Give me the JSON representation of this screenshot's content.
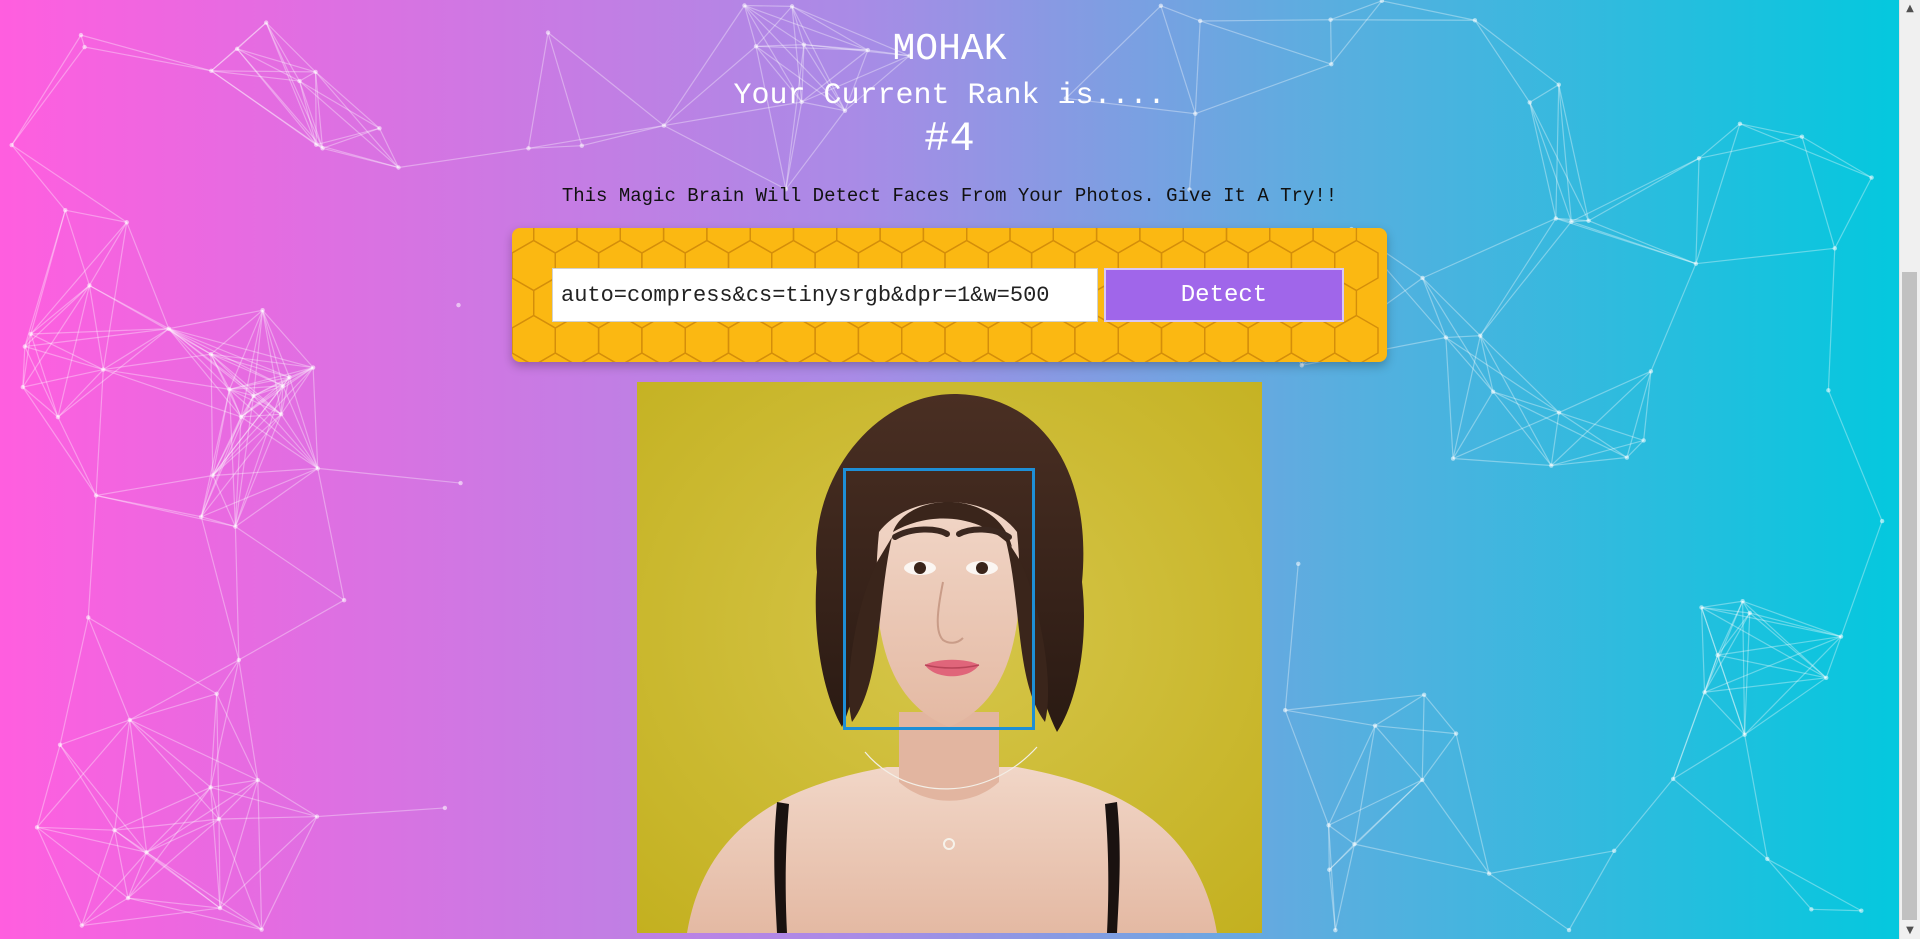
{
  "user": {
    "name": "MOHAK",
    "rank_label": "Your Current Rank is....",
    "rank_value": "#4"
  },
  "tagline": "This Magic Brain Will Detect Faces From Your Photos. Give It A Try!!",
  "form": {
    "url_value": "auto=compress&cs=tinysrgb&dpr=1&w=500",
    "detect_label": "Detect"
  },
  "colors": {
    "gradient_left": "#ff5edf",
    "gradient_right": "#04c8de",
    "form_background": "#fbb812",
    "button": "#a066ea",
    "face_box": "#1e8fd6"
  },
  "scrollbar": {
    "up_icon": "chevron-up-icon",
    "down_icon": "chevron-down-icon"
  }
}
